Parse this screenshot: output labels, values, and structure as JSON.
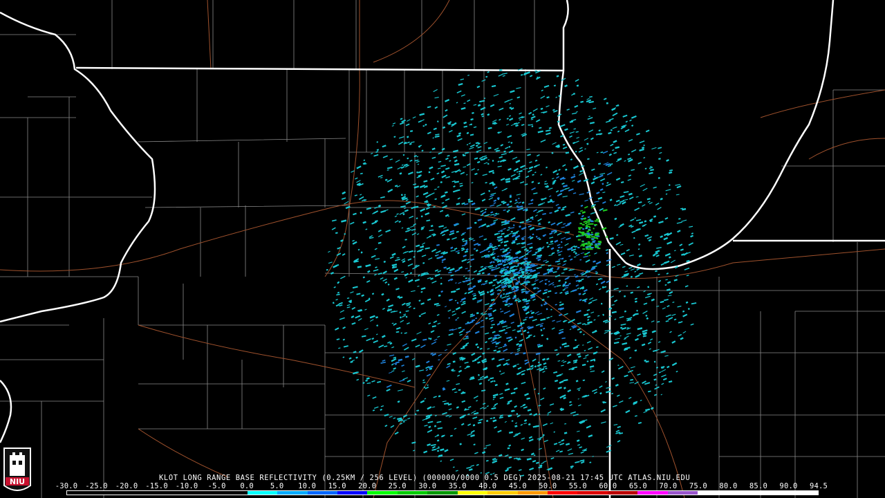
{
  "header": {
    "caption": "KLOT LONG RANGE BASE REFLECTIVITY (0.25KM / 256 LEVEL) (000000/0000 0.5 DEG) 2025-08-21 17:45 UTC  ATLAS.NIU.EDU"
  },
  "logo": {
    "text": "NIU"
  },
  "legend": {
    "ticks": [
      "-30.0",
      "-25.0",
      "-20.0",
      "-15.0",
      "-10.0",
      "-5.0",
      "0.0",
      "5.0",
      "10.0",
      "15.0",
      "20.0",
      "25.0",
      "30.0",
      "35.0",
      "40.0",
      "45.0",
      "50.0",
      "55.0",
      "60.0",
      "65.0",
      "70.0",
      "75.0",
      "80.0",
      "85.0",
      "90.0",
      "94.5"
    ],
    "colors": [
      "#000000",
      "#000000",
      "#000000",
      "#000000",
      "#000000",
      "#000000",
      "#00ffff",
      "#00aaff",
      "#0066ff",
      "#0000ff",
      "#00ff00",
      "#00cc00",
      "#009900",
      "#ffff00",
      "#ffcc00",
      "#ff9900",
      "#ff0000",
      "#dd0000",
      "#bb0000",
      "#ff00ff",
      "#9955cc",
      "#ffffff",
      "#ffffff",
      "#ffffff",
      "#ffffff"
    ]
  },
  "map": {
    "colors": {
      "state_lines": "#ffffff",
      "county_lines": "#8a8a8a",
      "roads": "#a0522d",
      "echo_light": "#19c8d2",
      "echo_mid": "#1e82dc",
      "echo_strong": "#1ec81e"
    }
  }
}
